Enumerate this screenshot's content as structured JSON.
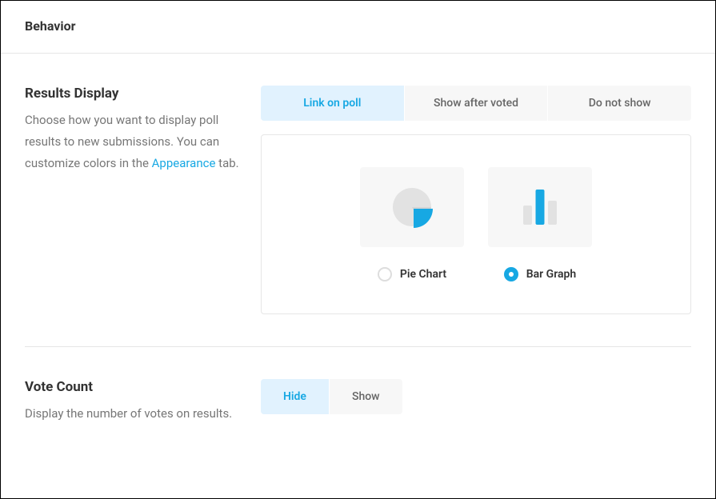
{
  "header": {
    "title": "Behavior"
  },
  "resultsDisplay": {
    "title": "Results Display",
    "desc_before_link": "Choose how you want to display poll results to new submissions. You can customize colors in the ",
    "link_label": "Appearance",
    "desc_after_link": " tab.",
    "tabs": {
      "link_on_poll": "Link on poll",
      "show_after_voted": "Show after voted",
      "do_not_show": "Do not show"
    },
    "chartOptions": {
      "pie": "Pie Chart",
      "bar": "Bar Graph"
    }
  },
  "voteCount": {
    "title": "Vote Count",
    "desc": "Display the number of votes on results.",
    "tabs": {
      "hide": "Hide",
      "show": "Show"
    }
  }
}
